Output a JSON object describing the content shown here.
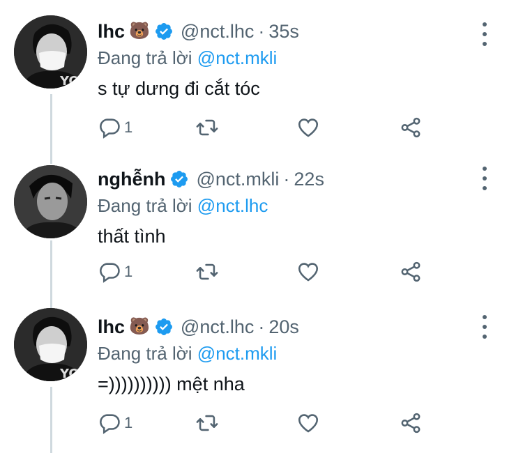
{
  "tweets": [
    {
      "name": "lhc",
      "emoji": "🐻",
      "handle": "@nct.lhc",
      "separator": "·",
      "time": "35s",
      "reply_prefix": "Đang trả lời",
      "reply_to": "@nct.mkli",
      "text": "s tự dưng đi cắt tóc",
      "reply_count": "1",
      "avatar": "avatar-masked-person"
    },
    {
      "name": "nghễnh",
      "emoji": "",
      "handle": "@nct.mkli",
      "separator": "·",
      "time": "22s",
      "reply_prefix": "Đang trả lời",
      "reply_to": "@nct.lhc",
      "text": "thất tình",
      "reply_count": "1",
      "avatar": "avatar-person-bw"
    },
    {
      "name": "lhc",
      "emoji": "🐻",
      "handle": "@nct.lhc",
      "separator": "·",
      "time": "20s",
      "reply_prefix": "Đang trả lời",
      "reply_to": "@nct.mkli",
      "text": "=)))))))))) mệt nha",
      "reply_count": "1",
      "avatar": "avatar-masked-person"
    }
  ],
  "colors": {
    "accent": "#1d9bf0",
    "muted": "#536471",
    "thread_line": "#cfd9de",
    "text": "#0f1419"
  },
  "icons": {
    "verified": "verified-badge-icon",
    "reply": "reply-icon",
    "retweet": "retweet-icon",
    "like": "heart-icon",
    "share": "share-icon",
    "more": "more-options-icon"
  }
}
